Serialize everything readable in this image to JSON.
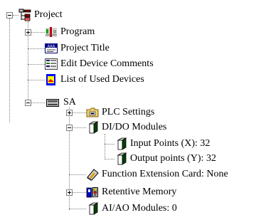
{
  "tree": {
    "root": {
      "label": "Project",
      "expanded": true,
      "icon": "project-tree-icon"
    },
    "program": {
      "label": "Program",
      "expanded": false,
      "icon": "program-icon"
    },
    "project_title": {
      "label": "Project Title",
      "icon": "project-title-icon"
    },
    "edit_device_comments": {
      "label": "Edit Device Comments",
      "icon": "device-comments-icon"
    },
    "list_of_used_devices": {
      "label": "List of Used Devices",
      "icon": "device-list-icon"
    },
    "sa": {
      "label": "SA",
      "expanded": true,
      "icon": "plc-unit-icon"
    },
    "plc_settings": {
      "label": "PLC Settings",
      "expanded": false,
      "icon": "folder-settings-icon"
    },
    "dido_modules": {
      "label": "DI/DO Modules",
      "expanded": true,
      "icon": "io-module-icon"
    },
    "input_points": {
      "label": "Input Points (X): 32",
      "icon": "io-module-icon"
    },
    "output_points": {
      "label": "Output points (Y): 32",
      "icon": "io-module-icon"
    },
    "function_extension_card": {
      "label": "Function Extension Card: None",
      "icon": "extension-card-icon"
    },
    "retentive_memory": {
      "label": "Retentive Memory",
      "expanded": false,
      "icon": "retentive-memory-icon"
    },
    "aiao_modules": {
      "label": "AI/AO Modules: 0",
      "icon": "io-module-icon"
    }
  }
}
